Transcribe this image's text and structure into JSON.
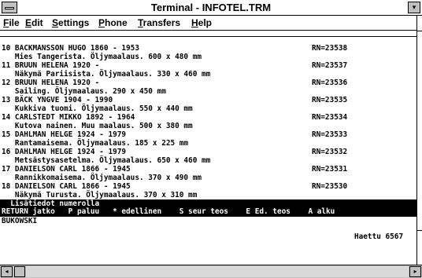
{
  "window": {
    "title": "Terminal - INFOTEL.TRM",
    "max_glyph": "▾",
    "left_arrow": "◂",
    "right_arrow": "▸"
  },
  "menu": [
    {
      "label": "File",
      "u": "F",
      "rest": "ile"
    },
    {
      "label": "Edit",
      "u": "E",
      "rest": "dit"
    },
    {
      "label": "Settings",
      "u": "S",
      "rest": "ettings"
    },
    {
      "label": "Phone",
      "u": "P",
      "rest": "hone"
    },
    {
      "label": "Transfers",
      "u": "T",
      "rest": "ransfers"
    },
    {
      "label": "Help",
      "u": "H",
      "rest": "elp"
    }
  ],
  "records": [
    {
      "head": "10 BACKMANSSON HUGO 1860 - 1953",
      "detail": "   Mies Tangerista. Öljymaalaus. 600 x 480 mm",
      "rn": "RN=23538"
    },
    {
      "head": "11 BRUUN HELENA 1920 -",
      "detail": "   Näkymä Pariisista. Öljymaalaus. 330 x 460 mm",
      "rn": "RN=23537"
    },
    {
      "head": "12 BRUUN HELENA 1920 -",
      "detail": "   Sailing. Öljymaalaus. 290 x 450 mm",
      "rn": "RN=23536"
    },
    {
      "head": "13 BÄCK YNGVE 1904 - 1990",
      "detail": "   Kukkiva tuomi. Öljymaalaus. 550 x 440 mm",
      "rn": "RN=23535"
    },
    {
      "head": "14 CARLSTEDT MIKKO 1892 - 1964",
      "detail": "   Kutova nainen. Muu maalaus. 500 x 380 mm",
      "rn": "RN=23534"
    },
    {
      "head": "15 DAHLMAN HELGE 1924 - 1979",
      "detail": "   Rantamaisema. Öljymaalaus. 185 x 225 mm",
      "rn": "RN=23533"
    },
    {
      "head": "16 DAHLMAN HELGE 1924 - 1979",
      "detail": "   Metsästysasetelma. Öljymaalaus. 650 x 460 mm",
      "rn": "RN=23532"
    },
    {
      "head": "17 DANIELSON CARL 1866 - 1945",
      "detail": "   Rannikkomaisema. Öljymaalaus. 370 x 490 mm",
      "rn": "RN=23531"
    },
    {
      "head": "18 DANIELSON CARL 1866 - 1945",
      "detail": "   Näkymä Turusta. Öljymaalaus. 370 x 310 mm",
      "rn": "RN=23530"
    }
  ],
  "footer": {
    "line1": "  Lisätiedot numerolla",
    "line2": "RETURN jatko   P paluu   * edellinen    S seur teos    E Ed. teos    A alku"
  },
  "query": "BUKOWSKI",
  "hits": "Haettu 6567"
}
